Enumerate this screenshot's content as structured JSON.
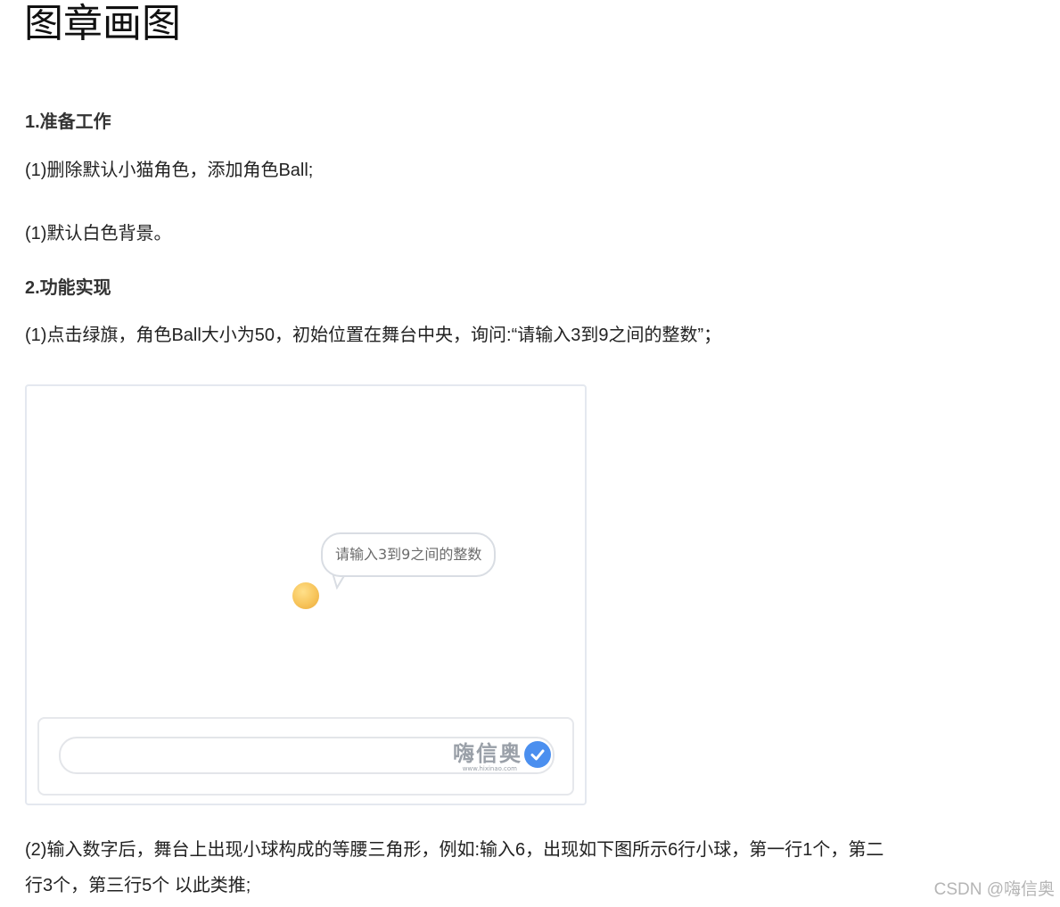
{
  "title": "图章画图",
  "section1": {
    "heading": "1.准备工作",
    "items": [
      "(1)删除默认小猫角色，添加角色Ball;",
      "(1)默认白色背景。"
    ]
  },
  "section2": {
    "heading": "2.功能实现",
    "item1": "(1)点击绿旗，角色Ball大小为50，初始位置在舞台中央，询问:“请输入3到9之间的整数”；",
    "item2_line1": "(2)输入数字后，舞台上出现小球构成的等腰三角形，例如:输入6，出现如下图所示6行小球，第一行1个，第二",
    "item2_line2": "行3个，第三行5个 以此类推;"
  },
  "stage": {
    "speech_bubble": "请输入3到9之间的整数",
    "watermark_text": "嗨信奥",
    "watermark_url": "www.hixinao.com"
  },
  "footer_watermark": "CSDN @嗨信奥",
  "colors": {
    "ball": "#f7c45a",
    "check_button": "#4b8fef"
  },
  "icons": [
    "check-icon"
  ]
}
